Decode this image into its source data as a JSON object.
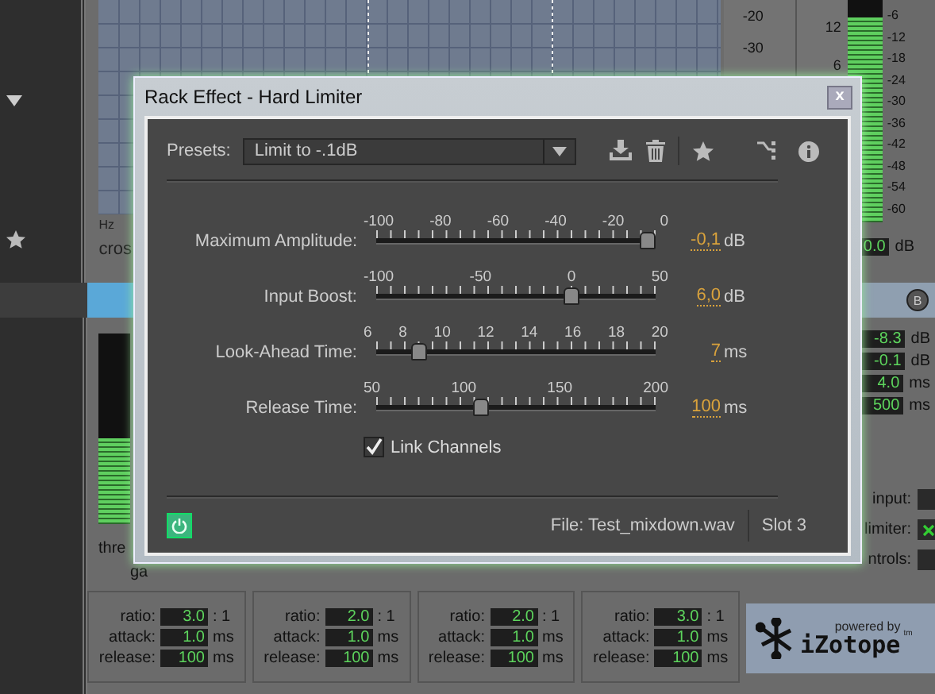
{
  "background": {
    "axis_label": "Hz",
    "caption": "cros",
    "scale_a": [
      "-20",
      "-30"
    ],
    "scale_b": [
      "12",
      "6"
    ],
    "meter": {
      "level": 0.92
    },
    "meter_scale": [
      "-6",
      "-12",
      "-18",
      "-24",
      "-30",
      "-36",
      "-42",
      "-48",
      "-54",
      "-60"
    ],
    "meter_readout": {
      "value": "0.0",
      "unit": "dB"
    },
    "band_button": "B",
    "readouts": [
      {
        "value": "-8.3",
        "unit": "dB"
      },
      {
        "value": "-0.1",
        "unit": "dB"
      },
      {
        "value": "4.0",
        "unit": "ms"
      },
      {
        "value": "500",
        "unit": "ms"
      }
    ],
    "left_meter": {
      "level": 0.45
    },
    "side_labels": [
      "thre",
      "ga"
    ],
    "bands": [
      {
        "fields": [
          {
            "label": "ratio:",
            "value": "3.0",
            "unit": ": 1"
          },
          {
            "label": "attack:",
            "value": "1.0",
            "unit": "ms"
          },
          {
            "label": "release:",
            "value": "100",
            "unit": "ms"
          }
        ]
      },
      {
        "fields": [
          {
            "label": "ratio:",
            "value": "2.0",
            "unit": ": 1"
          },
          {
            "label": "attack:",
            "value": "1.0",
            "unit": "ms"
          },
          {
            "label": "release:",
            "value": "100",
            "unit": "ms"
          }
        ]
      },
      {
        "fields": [
          {
            "label": "ratio:",
            "value": "2.0",
            "unit": ": 1"
          },
          {
            "label": "attack:",
            "value": "1.0",
            "unit": "ms"
          },
          {
            "label": "release:",
            "value": "100",
            "unit": "ms"
          }
        ]
      },
      {
        "fields": [
          {
            "label": "ratio:",
            "value": "3.0",
            "unit": ": 1"
          },
          {
            "label": "attack:",
            "value": "1.0",
            "unit": "ms"
          },
          {
            "label": "release:",
            "value": "100",
            "unit": "ms"
          }
        ]
      }
    ],
    "options": [
      {
        "label": "input:",
        "checked": false
      },
      {
        "label": "limiter:",
        "checked": true
      },
      {
        "label": "ntrols:",
        "checked": false
      }
    ],
    "logo": {
      "tagline": "powered by",
      "name": "iZotope",
      "tm": "tm"
    }
  },
  "dialog": {
    "title": "Rack Effect - Hard Limiter",
    "close": "x",
    "presets_label": "Presets:",
    "preset": "Limit to -.1dB",
    "sliders": [
      {
        "label": "Maximum Amplitude:",
        "ticks": [
          "-100",
          "-80",
          "-60",
          "-40",
          "-20",
          "0"
        ],
        "level": 1.0,
        "value": "-0,1",
        "unit": "dB"
      },
      {
        "label": "Input Boost:",
        "ticks": [
          "-100",
          "-50",
          "0",
          "50"
        ],
        "level": 0.71,
        "value": "6,0",
        "unit": "dB"
      },
      {
        "label": "Look-Ahead Time:",
        "ticks": [
          "6",
          "8",
          "10",
          "12",
          "14",
          "16",
          "18",
          "20"
        ],
        "level": 0.13,
        "value": "7",
        "unit": "ms"
      },
      {
        "label": "Release Time:",
        "ticks": [
          "50",
          "100",
          "150",
          "200"
        ],
        "level": 0.37,
        "value": "100",
        "unit": "ms"
      }
    ],
    "link_channels": {
      "label": "Link Channels",
      "checked": true
    },
    "power": {
      "on": true
    },
    "file": "File: Test_mixdown.wav",
    "slot": "Slot 3"
  }
}
